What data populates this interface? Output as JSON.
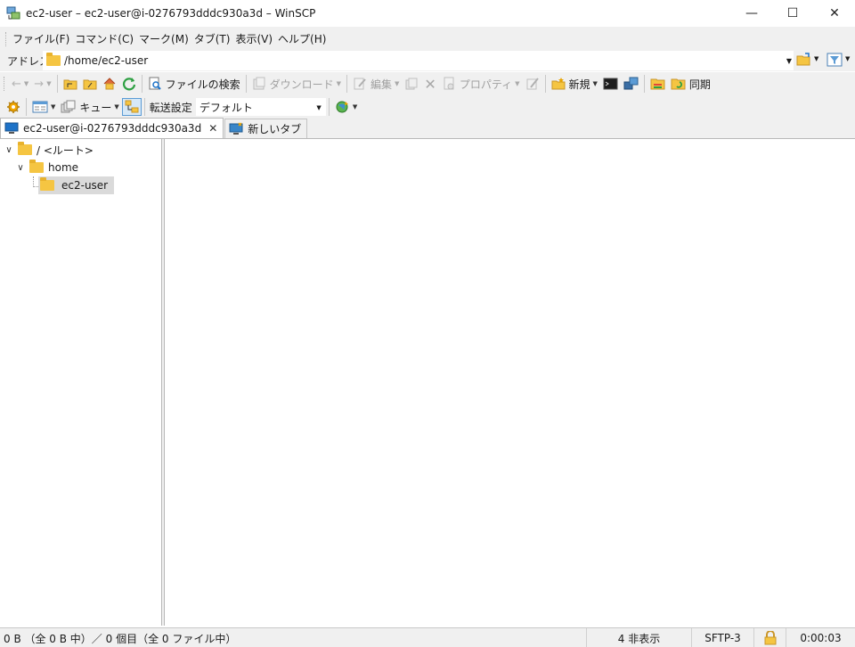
{
  "window": {
    "title": "ec2-user – ec2-user@i-0276793dddc930a3d – WinSCP",
    "controls": {
      "minimize": "—",
      "maximize": "☐",
      "close": "✕"
    }
  },
  "menu": {
    "items": [
      "ファイル(F)",
      "コマンド(C)",
      "マーク(M)",
      "タブ(T)",
      "表示(V)",
      "ヘルプ(H)"
    ]
  },
  "address": {
    "label": "アドレス",
    "path": "/home/ec2-user"
  },
  "toolbar1": {
    "find_files": "ファイルの検索",
    "download": "ダウンロード",
    "edit": "編集",
    "properties": "プロパティ",
    "new": "新規",
    "sync": "同期"
  },
  "toolbar2": {
    "queue": "キュー",
    "transfer_label": "転送設定",
    "transfer_value": "デフォルト"
  },
  "tabs": [
    {
      "label": "ec2-user@i-0276793dddc930a3d",
      "active": true
    },
    {
      "label": "新しいタブ",
      "active": false
    }
  ],
  "tree": [
    {
      "label": "/ <ルート>",
      "expanded": true,
      "level": 0
    },
    {
      "label": "home",
      "expanded": true,
      "level": 1
    },
    {
      "label": "ec2-user",
      "expanded": false,
      "level": 2,
      "selected": true
    }
  ],
  "status": {
    "selection": "0 B （全 0 B 中）／ 0 個目（全 0 ファイル中）",
    "hidden": "4 非表示",
    "protocol": "SFTP-3",
    "elapsed": "0:00:03"
  },
  "colors": {
    "folder": "#f5c542",
    "chrome": "#f0f0f0",
    "accent_blue": "#1e73c8",
    "refresh_green": "#2ea043"
  },
  "icons": [
    "app-icon",
    "back-icon",
    "forward-icon",
    "parent-dir-icon",
    "root-dir-icon",
    "home-icon",
    "refresh-icon",
    "find-icon",
    "download-icon",
    "edit-icon",
    "copy-icon",
    "delete-icon",
    "properties-icon",
    "rename-icon",
    "new-icon",
    "terminal-icon",
    "session-icon",
    "sync-browse-icon",
    "sync-icon",
    "preferences-icon",
    "view-icon",
    "queue-icon",
    "tree-toggle-icon",
    "globe-icon",
    "lock-icon",
    "close-icon",
    "filter-icon",
    "open-folder-icon"
  ]
}
